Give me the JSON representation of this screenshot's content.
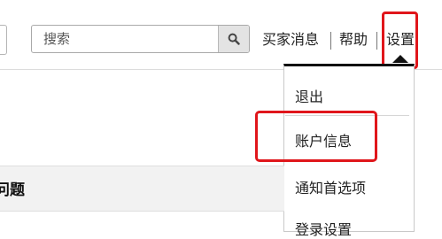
{
  "search": {
    "placeholder": "搜索"
  },
  "nav": {
    "buyer_messages": "买家消息",
    "help": "帮助",
    "settings": "设置"
  },
  "settings_menu": {
    "items": [
      "退出",
      "账户信息",
      "通知首选项",
      "登录设置"
    ]
  },
  "section": {
    "title": "问题"
  },
  "colors": {
    "highlight": "#e0161b",
    "search_button": "#e3e3e3",
    "section_background": "#f2f2f2"
  }
}
